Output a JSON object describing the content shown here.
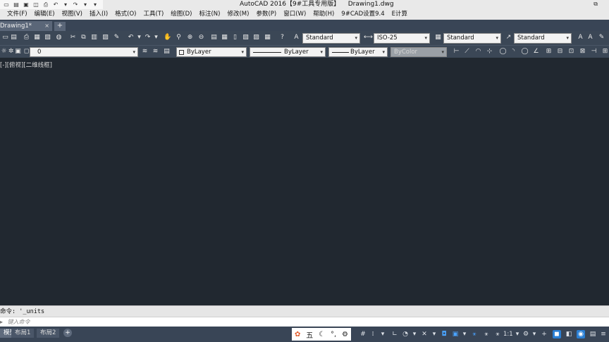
{
  "window": {
    "title": "AutoCAD 2016【9#工具专用版】    Drawing1.dwg",
    "restore_glyph": "⧉"
  },
  "qat_icons": [
    "new-icon",
    "open-icon",
    "save-icon",
    "saveas-icon",
    "print-icon",
    "undo-icon",
    "undo-dropdown-icon",
    "redo-icon",
    "redo-dropdown-icon",
    "customize-icon"
  ],
  "menu": [
    "文件(F)",
    "编辑(E)",
    "视图(V)",
    "插入(I)",
    "格式(O)",
    "工具(T)",
    "绘图(D)",
    "标注(N)",
    "修改(M)",
    "参数(P)",
    "窗口(W)",
    "帮助(H)",
    "9#CAD设置9.4",
    "E计算"
  ],
  "doc_tab": {
    "label": "Drawing1*",
    "close": "×",
    "new": "+"
  },
  "styles": {
    "text_style": "Standard",
    "dim_style": "ISO-25",
    "table_style": "Standard",
    "mleader_style": "Standard"
  },
  "layers": {
    "current_layer": "0",
    "color": "ByLayer",
    "linetype": "ByLayer",
    "lineweight": "ByLayer",
    "plot_style": "ByColor"
  },
  "viewport": {
    "label": "[-][俯视][二维线框]"
  },
  "command": {
    "history": "命令: '_units",
    "placeholder": "键入命令"
  },
  "layout_tabs": [
    "模型",
    "布局1",
    "布局2"
  ],
  "ime": {
    "mode_glyph": "五"
  },
  "status": {
    "annotation_scale": "1:1"
  },
  "colors": {
    "canvas": "#212830",
    "toolbar": "#3b4756",
    "menubar": "#e9e9e9",
    "accent": "#2a7fd4"
  }
}
